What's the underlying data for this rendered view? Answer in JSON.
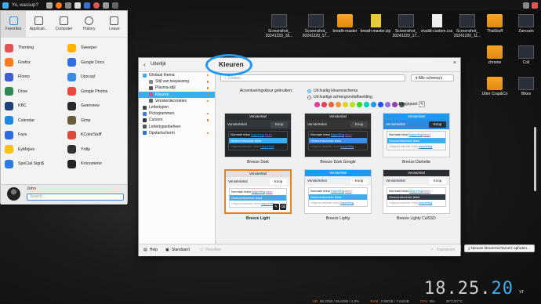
{
  "topbar": {
    "title": "Yo, wassup?"
  },
  "launcher": {
    "tabs": [
      {
        "label": "Favorites"
      },
      {
        "label": "Applicati..."
      },
      {
        "label": "Computer"
      },
      {
        "label": "History"
      },
      {
        "label": "Leave"
      }
    ],
    "apps": [
      {
        "name": "Theming",
        "color": "#e05656"
      },
      {
        "name": "Sweeper",
        "color": "#ffb400"
      },
      {
        "name": "Firefox",
        "color": "#ff7b1c"
      },
      {
        "name": "Google Docs",
        "color": "#2f6fe0"
      },
      {
        "name": "Floorp",
        "color": "#3f5fd0"
      },
      {
        "name": "Upscayl",
        "color": "#3a8be0"
      },
      {
        "name": "Drive",
        "color": "#2e8a52"
      },
      {
        "name": "Google Photos",
        "color": "#e64b3c"
      },
      {
        "name": "KBC",
        "color": "#1f3f7a"
      },
      {
        "name": "Gwenview",
        "color": "#2a2a2a"
      },
      {
        "name": "Calendar",
        "color": "#1e88e5"
      },
      {
        "name": "Gimp",
        "color": "#6b5b3a"
      },
      {
        "name": "Favs",
        "color": "#2b6de0"
      },
      {
        "name": "KColorStuff",
        "color": "#d94c3a"
      },
      {
        "name": "EyMojies",
        "color": "#f4c21b"
      },
      {
        "name": "Yrdlp",
        "color": "#333333"
      },
      {
        "name": "SpeCial Sign$",
        "color": "#2c7be5"
      },
      {
        "name": "Kronometer",
        "color": "#222222"
      }
    ],
    "user": {
      "name": "John",
      "search_placeholder": "Search..."
    }
  },
  "desktop": {
    "icons": [
      {
        "label": "Screenshot_ 20241220_18...",
        "type": "shot"
      },
      {
        "label": "Screenshot_ 20241220_17...",
        "type": "shot"
      },
      {
        "label": "breath-master",
        "type": "folder"
      },
      {
        "label": "breath-master.zip",
        "type": "zip"
      },
      {
        "label": "Screenshot_ 20241220_17...",
        "type": "shot"
      },
      {
        "label": "vivaldi-custom.css",
        "type": "txt"
      },
      {
        "label": "Screenshot_ 20241220_11...",
        "type": "shot"
      }
    ],
    "right_icons": [
      {
        "label": "ThatStuff",
        "type": "folder"
      },
      {
        "label": "Zamzam",
        "type": "shot"
      },
      {
        "label": "chrome",
        "type": "folder"
      },
      {
        "label": "Coll",
        "type": "shot"
      },
      {
        "label": "Utter Crap&Co",
        "type": "folder"
      },
      {
        "label": "Bikes",
        "type": "shot"
      }
    ]
  },
  "dialog": {
    "app_title": "Uiterlijk",
    "page_title": "Kleuren",
    "sidebar": [
      {
        "label": "Globaal thema",
        "sub": false,
        "dot": true,
        "active": false,
        "color": "#3daee9"
      },
      {
        "label": "Stijl van toepassing",
        "sub": true,
        "dot": true,
        "active": false,
        "color": "#888888"
      },
      {
        "label": "Plasma-stijl",
        "sub": true,
        "dot": true,
        "active": false,
        "color": "#555555"
      },
      {
        "label": "Kleuren",
        "sub": true,
        "dot": true,
        "active": true,
        "color": "#e04b8e"
      },
      {
        "label": "Vensterdecoraties",
        "sub": true,
        "dot": true,
        "active": false,
        "color": "#666666"
      },
      {
        "label": "Lettertypen",
        "sub": false,
        "dot": false,
        "active": false,
        "color": "#444444"
      },
      {
        "label": "Pictogrammen",
        "sub": false,
        "dot": true,
        "active": false,
        "color": "#3a7ee0"
      },
      {
        "label": "Cursors",
        "sub": false,
        "dot": true,
        "active": false,
        "color": "#333333"
      },
      {
        "label": "Lettertypenbeheer",
        "sub": false,
        "dot": false,
        "active": false,
        "color": "#555555"
      },
      {
        "label": "Opstartscherm",
        "sub": false,
        "dot": true,
        "active": false,
        "color": "#2c6fd0"
      }
    ],
    "search_placeholder": "Zoeken...",
    "scheme_filter": "Alle schema's",
    "accent_label": "Accentueringskleur gebruiken:",
    "radio_scheme": "Uit huidig kleurenschema",
    "radio_wallpaper": "Uit huidige achtergrondafbeelding",
    "custom_label": "Aangepast:",
    "swatches": [
      "#e93a9a",
      "#e93d58",
      "#e9643a",
      "#ef973c",
      "#e8cb2d",
      "#b6e521",
      "#3dd425",
      "#00d3b8",
      "#1d99f3",
      "#1e50f0",
      "#926ee4",
      "#8e44ad",
      "#555555"
    ],
    "cards": [
      {
        "caption": "Breeze Dark",
        "title": "Venstertitel",
        "header": "Venstertekst",
        "button": "Knop",
        "normal": "Normale tekst",
        "link1": "koppeling",
        "visited": "bezo",
        "selected": "Geaccentueerde tekst",
        "inactive": "Uitgeschakelde tekst",
        "link2": "koppeling",
        "tbar": "#2a2e32",
        "tcol": "#eee",
        "hbg": "#31363b",
        "hcol": "#eee",
        "kbg": "#40464c",
        "kcol": "#eee",
        "bbg": "#232629",
        "bcol": "#eee",
        "sel": "#3daee9",
        "selcol": "#fff",
        "dim": "#6e7175",
        "link": "#1d99f3"
      },
      {
        "caption": "Breeze Dark Google",
        "title": "Venstertitel",
        "header": "Venstertekst",
        "button": "Knop",
        "normal": "Normale tekst",
        "link1": "koppeling",
        "visited": "bezo",
        "selected": "Geaccentueerde tekst",
        "inactive": "Uitgeschakelde tekst",
        "link2": "koppeling",
        "tbar": "#2e2e2e",
        "tcol": "#eee",
        "hbg": "#353535",
        "hcol": "#eee",
        "kbg": "#454545",
        "kcol": "#eee",
        "bbg": "#282828",
        "bcol": "#eee",
        "sel": "#3d8ee9",
        "selcol": "#fff",
        "dim": "#707070",
        "link": "#5aa0f5"
      },
      {
        "caption": "Breeze Darkette",
        "title": "Venstertitel",
        "header": "Venstertekst",
        "button": "Knop",
        "normal": "Normale tekst",
        "link1": "koppeling",
        "visited": "bezo",
        "selected": "Geaccentueerde tekst",
        "inactive": "Uitgeschakelde tekst",
        "link2": "koppeling",
        "tbar": "#1d99f3",
        "tcol": "#fff",
        "hbg": "#2b8be0",
        "hcol": "#fff",
        "kbg": "#263238",
        "kcol": "#fff",
        "bbg": "#f7f7f7",
        "bcol": "#222",
        "sel": "#3daee9",
        "selcol": "#fff",
        "dim": "#a0a0a0",
        "link": "#2980b9"
      },
      {
        "caption": "Breeze Light",
        "title": "Venstertitel",
        "header": "Venstertekst",
        "button": "Knop",
        "normal": "Normale tekst",
        "link1": "koppeling",
        "visited": "bezo",
        "selected": "Geaccentueerde tekst",
        "inactive": "Uitgeschakelde tekst",
        "link2": "koppeling",
        "tbar": "#dedfe0",
        "tcol": "#222",
        "hbg": "#eff0f1",
        "hcol": "#222",
        "kbg": "#fcfcfc",
        "kcol": "#222",
        "bbg": "#fff",
        "bcol": "#222",
        "sel": "#3daee9",
        "selcol": "#fff",
        "dim": "#a0a0a0",
        "link": "#2980b9",
        "selected_card": true
      },
      {
        "caption": "Breeze Lighty",
        "title": "Venstertitel",
        "header": "Venstertekst",
        "button": "Knop",
        "normal": "Normale tekst",
        "link1": "koppeling",
        "visited": "bezo",
        "selected": "Geaccentueerde tekst",
        "inactive": "Uitgeschakelde tekst",
        "link2": "koppeling",
        "tbar": "#1d99f3",
        "tcol": "#fff",
        "hbg": "#eff0f1",
        "hcol": "#222",
        "kbg": "#fcfcfc",
        "kcol": "#222",
        "bbg": "#fff",
        "bcol": "#222",
        "sel": "#3daee9",
        "selcol": "#fff",
        "dim": "#a0a0a0",
        "link": "#2980b9"
      },
      {
        "caption": "Breeze Lighty CalSSD",
        "title": "Venstertitel",
        "header": "Venstertekst",
        "button": "Knop",
        "normal": "Normale tekst",
        "link1": "koppeling",
        "visited": "bezo",
        "selected": "Geaccentueerde tekst",
        "inactive": "Uitgeschakelde tekst",
        "link2": "koppeling",
        "tbar": "#2a2e32",
        "tcol": "#eee",
        "hbg": "#eff0f1",
        "hcol": "#222",
        "kbg": "#fcfcfc",
        "kcol": "#222",
        "bbg": "#fff",
        "bcol": "#222",
        "sel": "#2f3a45",
        "selcol": "#fff",
        "dim": "#a0a0a0",
        "link": "#2980b9"
      }
    ],
    "install_button": "Uit bestand installeren...",
    "new_button": "Nieuwe kleurenschema's ophalen...",
    "footer": {
      "help": "Help",
      "defaults": "Standaard",
      "reset": "Resetten",
      "apply": "Toepassen"
    }
  },
  "clock": {
    "time": "18.25.",
    "seconds": "20",
    "suffix": "vr"
  },
  "status": {
    "hd_label": "HD",
    "hd_value": "86.2GiB / 95.6GiB / 4.0%",
    "ram_label": "RAM",
    "ram_value": "2.99GiB / 7.64GiB",
    "cpu_label": "CPU",
    "cpu_value": "9%",
    "temp_value": "38°C/27°C"
  }
}
